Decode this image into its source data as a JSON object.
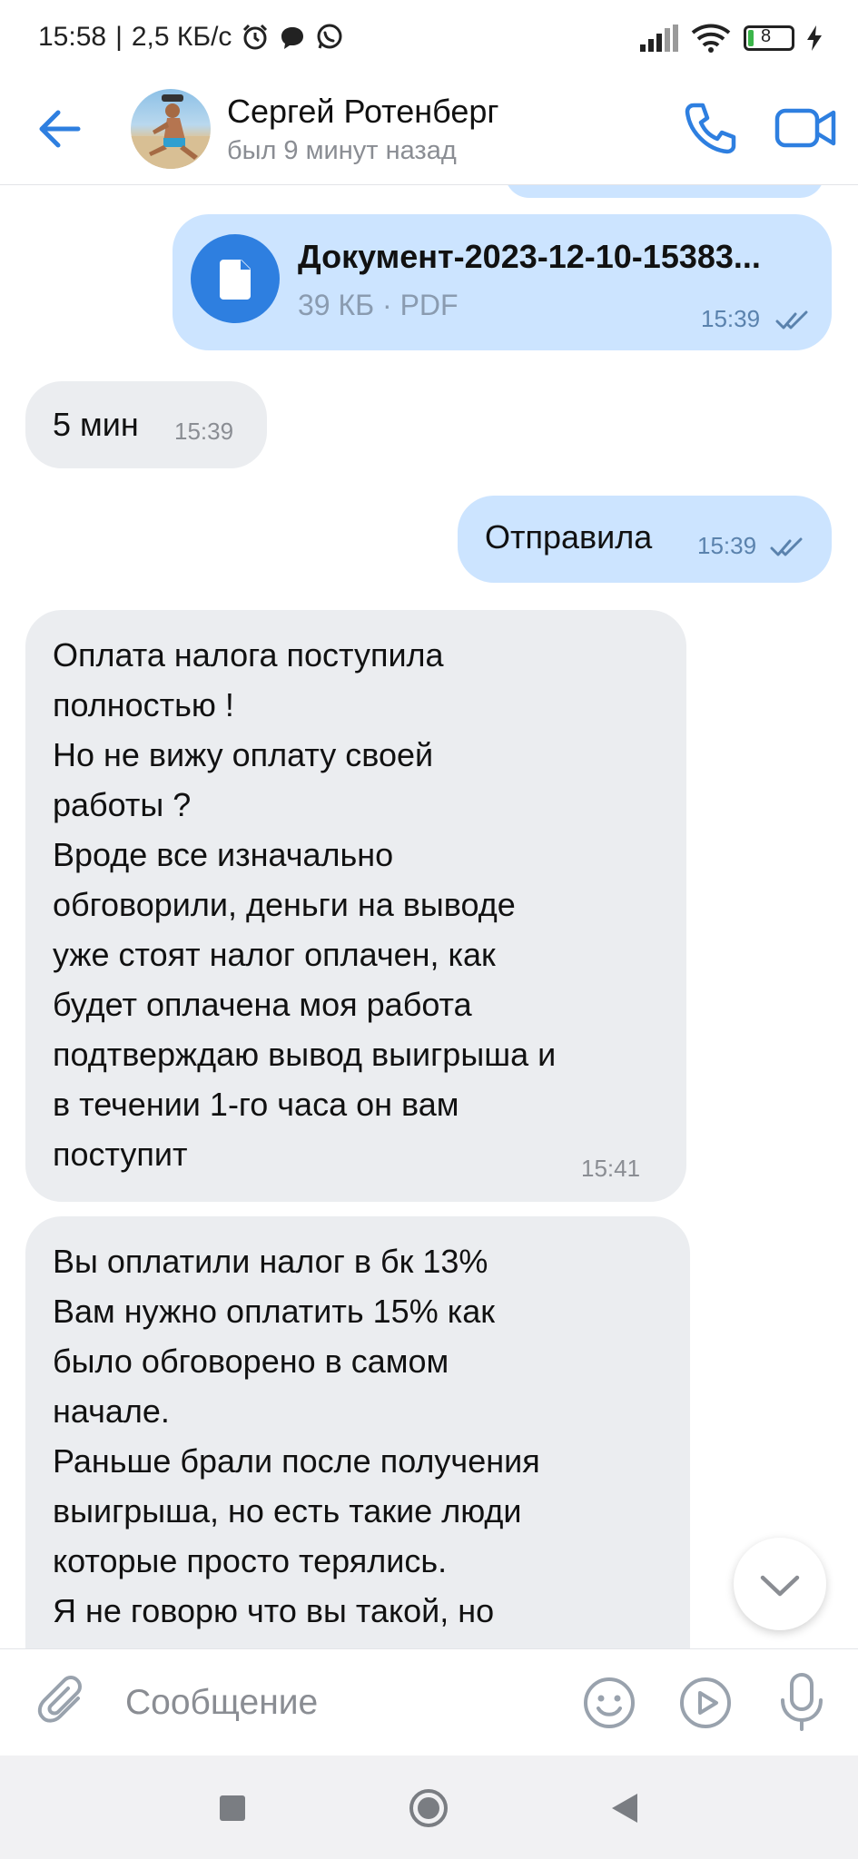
{
  "status_bar": {
    "time": "15:58",
    "separator": "|",
    "speed": "2,5 КБ/с",
    "battery": "8"
  },
  "header": {
    "contact_name": "Сергей Ротенберг",
    "contact_status": "был 9 минут назад"
  },
  "messages": [
    {
      "direction": "outgoing",
      "type": "file",
      "file_name": "Документ-2023-12-10-15383...",
      "file_meta": "39 КБ · PDF",
      "time": "15:39",
      "read": true
    },
    {
      "direction": "incoming",
      "type": "text",
      "text": "5 мин",
      "time": "15:39"
    },
    {
      "direction": "outgoing",
      "type": "text",
      "text": "Отправила",
      "time": "15:39",
      "read": true
    },
    {
      "direction": "incoming",
      "type": "text",
      "lines": [
        "Оплата налога поступила",
        "полностью !",
        "Но не вижу оплату своей",
        "работы ?",
        "Вроде все изначально",
        "обговорили, деньги на выводе",
        "уже стоят налог оплачен, как",
        "будет оплачена моя работа",
        "подтверждаю вывод выигрыша и",
        "в течении 1-го часа он вам",
        "поступит"
      ],
      "time": "15:41"
    },
    {
      "direction": "incoming",
      "type": "text",
      "lines": [
        "Вы оплатили налог в бк 13%",
        "Вам нужно оплатить 15% как",
        "было обговорено в самом",
        "начале.",
        "Раньше брали после получения",
        "выигрыша, но есть такие люди",
        "которые просто терялись.",
        "Я не говорю что вы такой, но"
      ]
    }
  ],
  "composer": {
    "placeholder": "Сообщение"
  },
  "colors": {
    "accent": "#2e7fe0",
    "outgoing_bubble": "#cce4ff",
    "incoming_bubble": "#ebedf0"
  },
  "icons": {
    "back": "arrow-left-icon",
    "call": "phone-icon",
    "video": "video-camera-icon",
    "attach": "paperclip-icon",
    "emoji": "smiley-icon",
    "play": "play-circle-icon",
    "mic": "microphone-icon",
    "scroll": "chevron-down-icon",
    "file": "document-icon"
  }
}
